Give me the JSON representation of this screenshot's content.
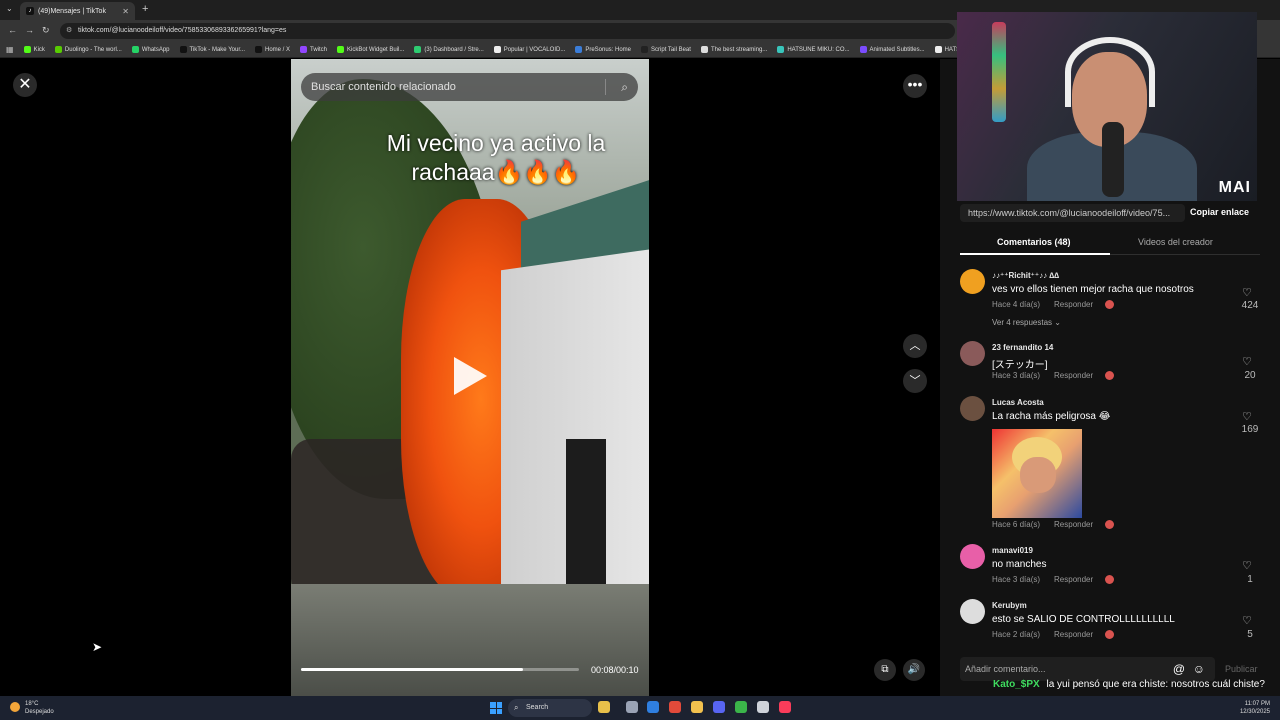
{
  "browser": {
    "tab_title": "(49)Mensajes | TikTok",
    "tab_icon": "tiktok-icon",
    "url": "tiktok.com/@lucianoodeiloff/video/7585330689336265991?lang=es",
    "bookmarks": [
      {
        "label": "Kick",
        "color": "#53fc18"
      },
      {
        "label": "Duolingo - The worl...",
        "color": "#58cc02"
      },
      {
        "label": "WhatsApp",
        "color": "#25d366"
      },
      {
        "label": "TikTok - Make Your...",
        "color": "#111111"
      },
      {
        "label": "Home / X",
        "color": "#111111"
      },
      {
        "label": "Twitch",
        "color": "#9146ff"
      },
      {
        "label": "KickBot Widget Buil...",
        "color": "#53fc18"
      },
      {
        "label": "(3) Dashboard / Stre...",
        "color": "#2ecc71"
      },
      {
        "label": "Popular | VOCALOID...",
        "color": "#eeeeee"
      },
      {
        "label": "PreSonus: Home",
        "color": "#3b7dd8"
      },
      {
        "label": "Script Tail Beat",
        "color": "#222222"
      },
      {
        "label": "The best streaming...",
        "color": "#dddddd"
      },
      {
        "label": "HATSUNE MIKU: CO...",
        "color": "#39c5bb"
      },
      {
        "label": "Animated Subtitles...",
        "color": "#7b4cff"
      },
      {
        "label": "HATSUN",
        "color": "#eeeeee"
      },
      {
        "label": "dores",
        "color": "#999999"
      }
    ]
  },
  "player": {
    "search_placeholder": "Buscar contenido relacionado",
    "caption": "Mi vecino ya activo la rachaaa🔥🔥🔥",
    "timecode": "00:08/00:10",
    "progress": 0.8
  },
  "overlay": {
    "brand": "MAI"
  },
  "panel": {
    "share_link": "https://www.tiktok.com/@lucianoodeiloff/video/75...",
    "copy_link": "Copiar enlace",
    "tabs": [
      "Comentarios (48)",
      "Videos del creador"
    ],
    "comments": [
      {
        "user": "♪♪⁺⁺Richit⁺⁺♪♪ ∆∆",
        "text": "ves vro ellos tienen mejor racha que nosotros",
        "time": "Hace 4 día(s)",
        "reply": "Responder",
        "likes": "424",
        "view_replies": "Ver 4 respuestas",
        "avatar_color": "#f0a020"
      },
      {
        "user": "23 fernandito 14",
        "text": "[ステッカー]",
        "time": "Hace 3 día(s)",
        "reply": "Responder",
        "likes": "20",
        "avatar_color": "#8a5a5a"
      },
      {
        "user": "Lucas Acosta",
        "text": "La racha más peligrosa 😂",
        "time": "Hace 6 día(s)",
        "reply": "Responder",
        "likes": "169",
        "avatar_color": "#6b5040"
      },
      {
        "user": "manavi019",
        "text": "no manches",
        "time": "Hace 3 día(s)",
        "reply": "Responder",
        "likes": "1",
        "avatar_color": "#e85fa8"
      },
      {
        "user": "Kerubym",
        "text": "esto se SALIO DE CONTROLLLLLLLLLL",
        "time": "Hace 2 día(s)",
        "reply": "Responder",
        "likes": "5",
        "avatar_color": "#dddddd"
      }
    ],
    "add_comment_placeholder": "Añadir comentario...",
    "publish": "Publicar"
  },
  "chat": {
    "user": "Kato_$PX",
    "message": "la yui pensó que era chiste: nosotros cuál chiste?"
  },
  "taskbar": {
    "temperature": "18°C",
    "weather": "Despejado",
    "search": "Search",
    "time": "11:07 PM",
    "date": "12/30/2025"
  }
}
